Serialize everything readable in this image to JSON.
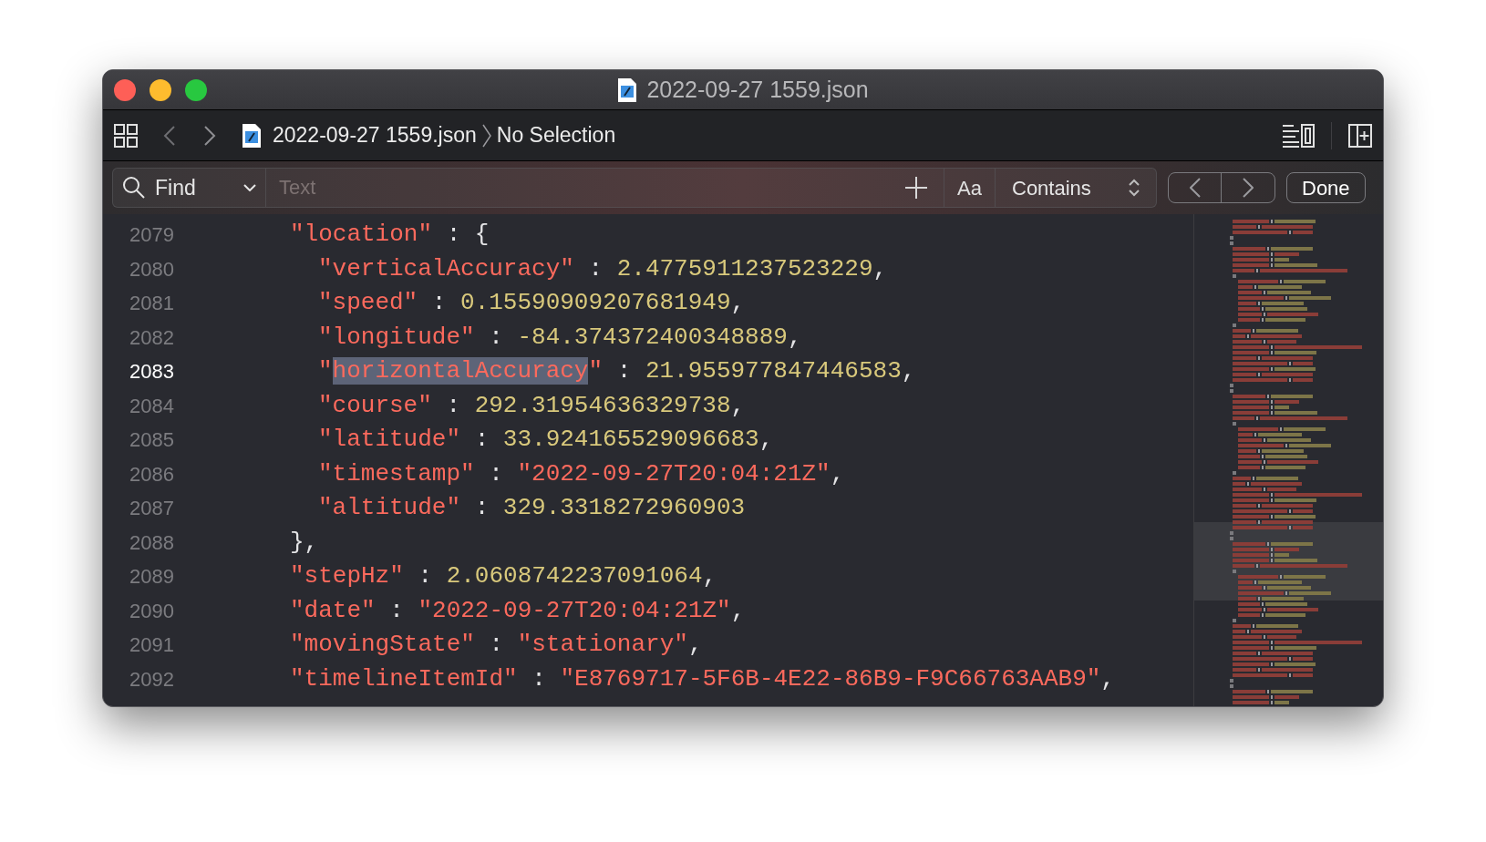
{
  "window": {
    "title": "2022-09-27 1559.json"
  },
  "toolbar": {
    "path": [
      {
        "kind": "file",
        "label": "2022-09-27 1559.json"
      },
      {
        "kind": "item",
        "label": "No Selection"
      }
    ]
  },
  "find_bar": {
    "mode": "Find",
    "placeholder": "Text",
    "case_button": "Aa",
    "match": "Contains",
    "done": "Done"
  },
  "editor": {
    "lines": [
      {
        "number": "2079",
        "current": false,
        "tokens": [
          {
            "kind": "key",
            "text": "\"location\""
          },
          {
            "kind": "punct",
            "text": " : {"
          }
        ],
        "children": [
          {
            "number": "2080",
            "current": false,
            "tokens": [
              {
                "kind": "key",
                "text": "\"verticalAccuracy\""
              },
              {
                "kind": "punct",
                "text": " : "
              },
              {
                "kind": "number",
                "text": "2.4775911237523229"
              },
              {
                "kind": "punct",
                "text": ","
              }
            ]
          },
          {
            "number": "2081",
            "current": false,
            "tokens": [
              {
                "kind": "key",
                "text": "\"speed\""
              },
              {
                "kind": "punct",
                "text": " : "
              },
              {
                "kind": "number",
                "text": "0.15590909207681949"
              },
              {
                "kind": "punct",
                "text": ","
              }
            ]
          },
          {
            "number": "2082",
            "current": false,
            "tokens": [
              {
                "kind": "key",
                "text": "\"longitude\""
              },
              {
                "kind": "punct",
                "text": " : "
              },
              {
                "kind": "number",
                "text": "-84.374372400348889"
              },
              {
                "kind": "punct",
                "text": ","
              }
            ]
          },
          {
            "number": "2083",
            "current": true,
            "tokens": [
              {
                "kind": "key",
                "text": "\""
              },
              {
                "kind": "key",
                "text": "horizontalAccuracy",
                "highlighted": true
              },
              {
                "kind": "key",
                "text": "\""
              },
              {
                "kind": "punct",
                "text": " : "
              },
              {
                "kind": "number",
                "text": "21.955977847446583"
              },
              {
                "kind": "punct",
                "text": ","
              }
            ]
          },
          {
            "number": "2084",
            "current": false,
            "tokens": [
              {
                "kind": "key",
                "text": "\"course\""
              },
              {
                "kind": "punct",
                "text": " : "
              },
              {
                "kind": "number",
                "text": "292.31954636329738"
              },
              {
                "kind": "punct",
                "text": ","
              }
            ]
          },
          {
            "number": "2085",
            "current": false,
            "tokens": [
              {
                "kind": "key",
                "text": "\"latitude\""
              },
              {
                "kind": "punct",
                "text": " : "
              },
              {
                "kind": "number",
                "text": "33.924165529096683"
              },
              {
                "kind": "punct",
                "text": ","
              }
            ]
          },
          {
            "number": "2086",
            "current": false,
            "tokens": [
              {
                "kind": "key",
                "text": "\"timestamp\""
              },
              {
                "kind": "punct",
                "text": " : "
              },
              {
                "kind": "string",
                "text": "\"2022-09-27T20:04:21Z\""
              },
              {
                "kind": "punct",
                "text": ","
              }
            ]
          },
          {
            "number": "2087",
            "current": false,
            "tokens": [
              {
                "kind": "key",
                "text": "\"altitude\""
              },
              {
                "kind": "punct",
                "text": " : "
              },
              {
                "kind": "number",
                "text": "329.3318272960903"
              }
            ]
          }
        ]
      },
      {
        "number": "2088",
        "current": false,
        "tokens": [
          {
            "kind": "punct",
            "text": "},"
          }
        ]
      },
      {
        "number": "2089",
        "current": false,
        "tokens": [
          {
            "kind": "key",
            "text": "\"stepHz\""
          },
          {
            "kind": "punct",
            "text": " : "
          },
          {
            "kind": "number",
            "text": "2.0608742237091064"
          },
          {
            "kind": "punct",
            "text": ","
          }
        ]
      },
      {
        "number": "2090",
        "current": false,
        "tokens": [
          {
            "kind": "key",
            "text": "\"date\""
          },
          {
            "kind": "punct",
            "text": " : "
          },
          {
            "kind": "string",
            "text": "\"2022-09-27T20:04:21Z\""
          },
          {
            "kind": "punct",
            "text": ","
          }
        ]
      },
      {
        "number": "2091",
        "current": false,
        "tokens": [
          {
            "kind": "key",
            "text": "\"movingState\""
          },
          {
            "kind": "punct",
            "text": " : "
          },
          {
            "kind": "string",
            "text": "\"stationary\""
          },
          {
            "kind": "punct",
            "text": ","
          }
        ]
      },
      {
        "number": "2092",
        "current": false,
        "tokens": [
          {
            "kind": "key",
            "text": "\"timelineItemId\""
          },
          {
            "kind": "punct",
            "text": " : "
          },
          {
            "kind": "string",
            "text": "\"E8769717-5F6B-4E22-86B9-F9C66763AAB9\""
          },
          {
            "kind": "punct",
            "text": ","
          }
        ]
      }
    ]
  }
}
